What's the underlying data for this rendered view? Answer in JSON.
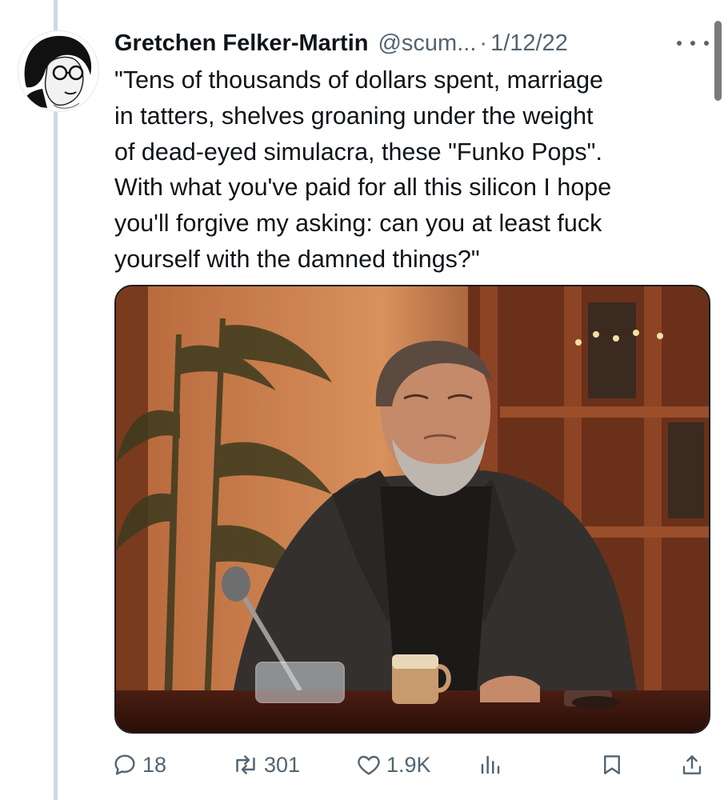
{
  "tweet": {
    "author_name": "Gretchen Felker-Martin",
    "handle": "@scum...",
    "separator": "·",
    "date": "1/12/22",
    "text_lines": [
      "\"Tens of thousands of dollars spent, marriage",
      "in tatters, shelves groaning under the weight",
      "of dead-eyed simulacra, these \"Funko Pops\".",
      "With what you've paid for all this silicon I hope",
      "you'll forgive my asking: can you at least fuck",
      "yourself with the damned things?\""
    ]
  },
  "actions": {
    "replies": "18",
    "retweets": "301",
    "likes": "1.9K"
  },
  "icons": {
    "reply": "reply-icon",
    "retweet": "retweet-icon",
    "like": "heart-icon",
    "views": "views-icon",
    "bookmark": "bookmark-icon",
    "share": "share-icon",
    "more": "more-icon"
  },
  "colors": {
    "text": "#0f1419",
    "secondary": "#536471",
    "thread_line": "#cfd9de"
  }
}
